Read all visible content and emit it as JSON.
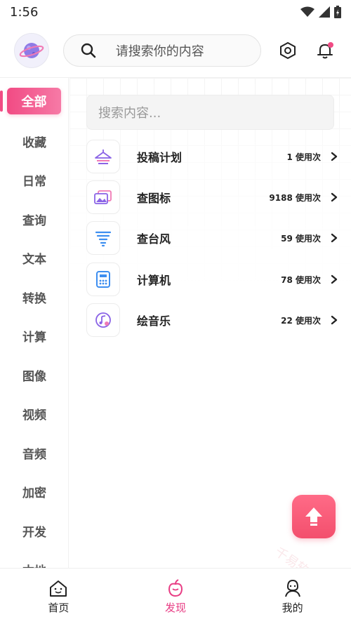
{
  "status_bar": {
    "time": "1:56"
  },
  "header": {
    "search_placeholder": "请搜索你的内容"
  },
  "sidebar": {
    "items": [
      {
        "label": "全部",
        "active": true
      },
      {
        "label": "收藏"
      },
      {
        "label": "日常"
      },
      {
        "label": "查询"
      },
      {
        "label": "文本"
      },
      {
        "label": "转换"
      },
      {
        "label": "计算"
      },
      {
        "label": "图像"
      },
      {
        "label": "视频"
      },
      {
        "label": "音频"
      },
      {
        "label": "加密"
      },
      {
        "label": "开发"
      },
      {
        "label": "本地"
      }
    ]
  },
  "main": {
    "search_placeholder": "搜索内容...",
    "tools": [
      {
        "name": "投稿计划",
        "count": "1 使用次",
        "icon": "hanger-icon"
      },
      {
        "name": "查图标",
        "count": "9188 使用次",
        "icon": "image-gallery-icon"
      },
      {
        "name": "查台风",
        "count": "59 使用次",
        "icon": "typhoon-icon"
      },
      {
        "name": "计算机",
        "count": "78 使用次",
        "icon": "calculator-icon"
      },
      {
        "name": "绘音乐",
        "count": "22 使用次",
        "icon": "music-note-icon"
      }
    ]
  },
  "bottom_nav": [
    {
      "label": "首页",
      "icon": "home-icon"
    },
    {
      "label": "发现",
      "icon": "discover-icon",
      "active": true
    },
    {
      "label": "我的",
      "icon": "profile-icon"
    }
  ],
  "watermark": "千易软件站",
  "colors": {
    "accent": "#f14b84",
    "fab": "#f34f6d",
    "icon_purple": "#8a63e6",
    "icon_blue": "#3d8ef0"
  }
}
